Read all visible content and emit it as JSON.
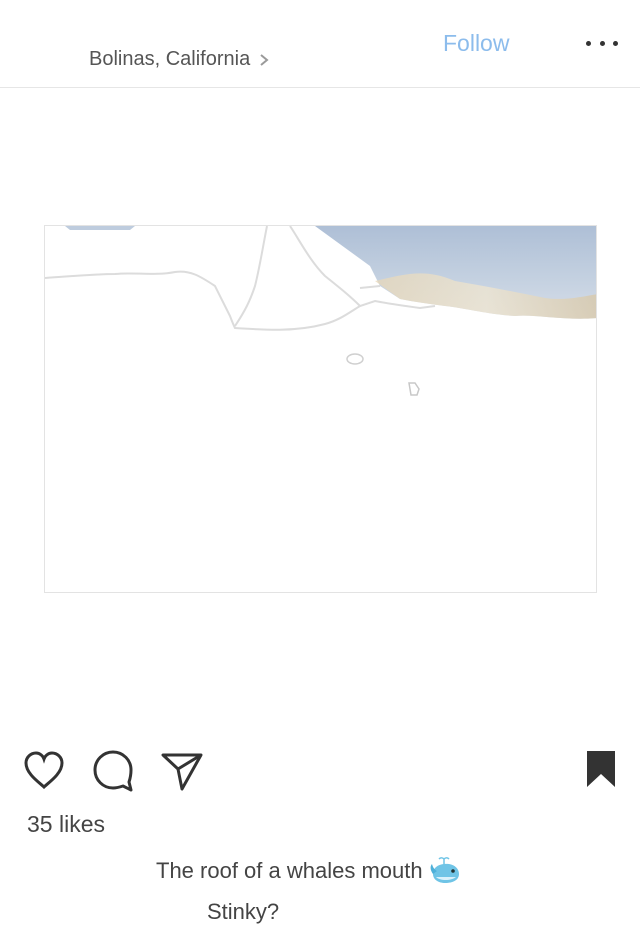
{
  "header": {
    "location": "Bolinas, California",
    "follow_label": "Follow"
  },
  "post": {
    "likes": "35 likes",
    "caption": "The roof of a whales mouth",
    "caption_emoji": "whale-emoji",
    "comment": "Stinky?"
  },
  "icons": {
    "location_chevron": "chevron-right-icon",
    "more": "more-options-icon",
    "like": "heart-icon",
    "comment": "comment-icon",
    "share": "share-icon",
    "save": "bookmark-icon"
  },
  "colors": {
    "follow": "#8cbcec",
    "text": "#444444",
    "ocean": "#b9c9dc",
    "divider": "#e6e6e6"
  }
}
